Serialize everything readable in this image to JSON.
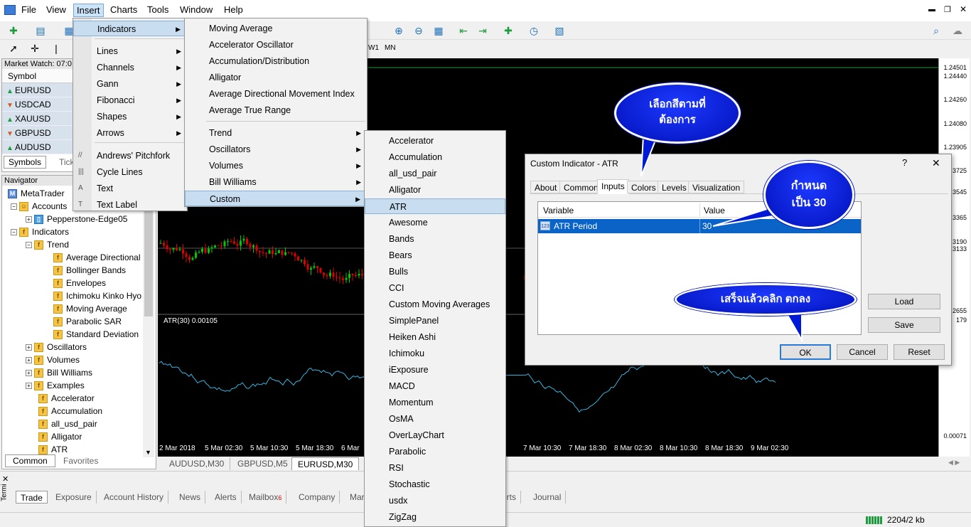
{
  "menubar": {
    "items": [
      "File",
      "View",
      "Insert",
      "Charts",
      "Tools",
      "Window",
      "Help"
    ],
    "selected": "Insert"
  },
  "timeframes": [
    "W1",
    "MN"
  ],
  "market_watch": {
    "title": "Market Watch: 07:0",
    "column": "Symbol",
    "symbols": [
      {
        "name": "EURUSD",
        "dir": "up"
      },
      {
        "name": "USDCAD",
        "dir": "down"
      },
      {
        "name": "XAUUSD",
        "dir": "up"
      },
      {
        "name": "GBPUSD",
        "dir": "down"
      },
      {
        "name": "AUDUSD",
        "dir": "up"
      }
    ],
    "tabs": [
      "Symbols",
      "Tick"
    ]
  },
  "navigator": {
    "title": "Navigator",
    "root": "MetaTrader",
    "accounts": "Accounts",
    "account": "Pepperstone-Edge05",
    "indicators": "Indicators",
    "trend": "Trend",
    "trend_items": [
      "Average Directional",
      "Bollinger Bands",
      "Envelopes",
      "Ichimoku Kinko Hyo",
      "Moving Average",
      "Parabolic SAR",
      "Standard Deviation"
    ],
    "groups": [
      "Oscillators",
      "Volumes",
      "Bill Williams",
      "Examples"
    ],
    "custom_items": [
      "Accelerator",
      "Accumulation",
      "all_usd_pair",
      "Alligator",
      "ATR"
    ],
    "tabs": [
      "Common",
      "Favorites"
    ]
  },
  "insert_menu": {
    "items": [
      "Indicators",
      "Lines",
      "Channels",
      "Gann",
      "Fibonacci",
      "Shapes",
      "Arrows",
      "Andrews' Pitchfork",
      "Cycle Lines",
      "Text",
      "Text Label"
    ]
  },
  "indicators_menu": {
    "items": [
      "Moving Average",
      "Accelerator Oscillator",
      "Accumulation/Distribution",
      "Alligator",
      "Average Directional Movement Index",
      "Average True Range",
      "Trend",
      "Oscillators",
      "Volumes",
      "Bill Williams",
      "Custom"
    ]
  },
  "custom_menu": {
    "items": [
      "Accelerator",
      "Accumulation",
      "all_usd_pair",
      "Alligator",
      "ATR",
      "Awesome",
      "Bands",
      "Bears",
      "Bulls",
      "CCI",
      "Custom Moving Averages",
      "SimplePanel",
      "Heiken Ashi",
      "Ichimoku",
      "iExposure",
      "MACD",
      "Momentum",
      "OsMA",
      "OverLayChart",
      "Parabolic",
      "RSI",
      "Stochastic",
      "usdx",
      "ZigZag"
    ]
  },
  "chart": {
    "subwindow_label": "ATR(30) 0.00105",
    "price_labels": [
      "1.24501",
      "1.24440",
      "1.24260",
      "1.24080",
      "1.23905",
      "3725",
      "3545",
      "3365",
      "3190",
      "3133",
      "2655",
      "179",
      "0.00071"
    ],
    "time_labels": [
      "2 Mar 2018",
      "5 Mar 02:30",
      "5 Mar 10:30",
      "5 Mar 18:30",
      "6 Mar",
      "7 Mar 10:30",
      "7 Mar 18:30",
      "8 Mar 02:30",
      "8 Mar 10:30",
      "8 Mar 18:30",
      "9 Mar 02:30"
    ],
    "tabs": [
      "AUDUSD,M30",
      "GBPUSD,M5",
      "EURUSD,M30"
    ],
    "active_tab": "EURUSD,M30"
  },
  "dialog": {
    "title": "Custom Indicator - ATR",
    "help": "?",
    "close": "✕",
    "tabs": [
      "About",
      "Common",
      "Inputs",
      "Colors",
      "Levels",
      "Visualization"
    ],
    "active_tab": "Inputs",
    "col_variable": "Variable",
    "col_value": "Value",
    "row_icon": "123",
    "row_variable": "ATR Period",
    "row_value": "30",
    "load": "Load",
    "save": "Save",
    "ok": "OK",
    "cancel": "Cancel",
    "reset": "Reset"
  },
  "callouts": {
    "colors": "เลือกสีตามที่\nต้องการ",
    "period": "กำหนด\nเป็น 30",
    "ok": "เสร็จแล้วคลิก ตกลง"
  },
  "terminal": {
    "label": "Termi",
    "tabs": [
      "Trade",
      "Exposure",
      "Account History",
      "News",
      "Alerts",
      "Mailbox",
      "Company",
      "Mar",
      "erts",
      "Journal"
    ],
    "mailbox_count": "6"
  },
  "status": {
    "traffic": "2204/2 kb"
  },
  "colors": {
    "bull": "#00c800",
    "bear": "#e00000",
    "atr": "#38b6e0",
    "highlight": "#0a64c8",
    "accent": "#1d39ff"
  }
}
